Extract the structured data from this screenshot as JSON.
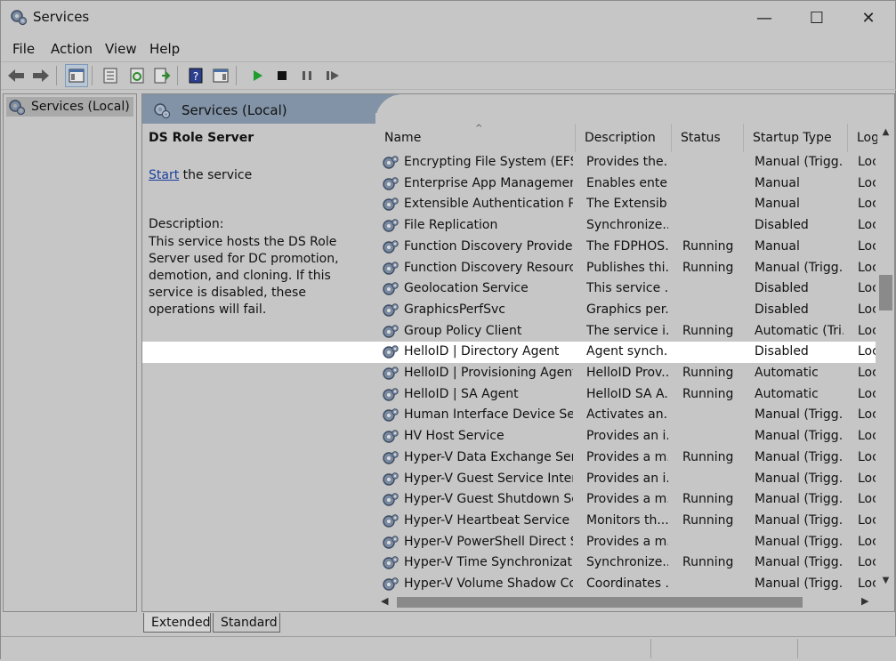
{
  "window": {
    "title": "Services",
    "controls": {
      "minimize": "—",
      "maximize": "☐",
      "close": "✕"
    }
  },
  "menu": {
    "file": "File",
    "action": "Action",
    "view": "View",
    "help": "Help"
  },
  "tree": {
    "item": "Services (Local)"
  },
  "pane": {
    "header": "Services (Local)"
  },
  "details": {
    "service_name": "DS Role Server",
    "start_link": "Start",
    "start_suffix": " the service",
    "description_label": "Description:",
    "description_text": "This service hosts the DS Role Server used for DC promotion, demotion, and cloning. If this service is disabled, these operations will fail."
  },
  "columns": {
    "name": "Name",
    "description": "Description",
    "status": "Status",
    "startup": "Startup Type",
    "log": "Log"
  },
  "rows": [
    {
      "name": "Encrypting File System (EFS)",
      "description": "Provides the...",
      "status": "",
      "startup": "Manual (Trigg...",
      "log": "Loc"
    },
    {
      "name": "Enterprise App Managemen...",
      "description": "Enables ente...",
      "status": "",
      "startup": "Manual",
      "log": "Loc"
    },
    {
      "name": "Extensible Authentication Pr...",
      "description": "The Extensib...",
      "status": "",
      "startup": "Manual",
      "log": "Loc"
    },
    {
      "name": "File Replication",
      "description": "Synchronize...",
      "status": "",
      "startup": "Disabled",
      "log": "Loc"
    },
    {
      "name": "Function Discovery Provider ...",
      "description": "The FDPHOS...",
      "status": "Running",
      "startup": "Manual",
      "log": "Loc"
    },
    {
      "name": "Function Discovery Resourc...",
      "description": "Publishes thi...",
      "status": "Running",
      "startup": "Manual (Trigg...",
      "log": "Loc"
    },
    {
      "name": "Geolocation Service",
      "description": "This service ...",
      "status": "",
      "startup": "Disabled",
      "log": "Loc"
    },
    {
      "name": "GraphicsPerfSvc",
      "description": "Graphics per...",
      "status": "",
      "startup": "Disabled",
      "log": "Loc"
    },
    {
      "name": "Group Policy Client",
      "description": "The service i...",
      "status": "Running",
      "startup": "Automatic (Tri...",
      "log": "Loc"
    },
    {
      "name": "HelloID | Directory Agent",
      "description": "Agent synch...",
      "status": "",
      "startup": "Disabled",
      "log": "Loc",
      "selected": true
    },
    {
      "name": "HelloID | Provisioning Agent",
      "description": "HelloID Prov...",
      "status": "Running",
      "startup": "Automatic",
      "log": "Loc"
    },
    {
      "name": "HelloID | SA Agent",
      "description": "HelloID SA A...",
      "status": "Running",
      "startup": "Automatic",
      "log": "Loc"
    },
    {
      "name": "Human Interface Device Serv...",
      "description": "Activates an...",
      "status": "",
      "startup": "Manual (Trigg...",
      "log": "Loc"
    },
    {
      "name": "HV Host Service",
      "description": "Provides an i...",
      "status": "",
      "startup": "Manual (Trigg...",
      "log": "Loc"
    },
    {
      "name": "Hyper-V Data Exchange Serv...",
      "description": "Provides a m...",
      "status": "Running",
      "startup": "Manual (Trigg...",
      "log": "Loc"
    },
    {
      "name": "Hyper-V Guest Service Interf...",
      "description": "Provides an i...",
      "status": "",
      "startup": "Manual (Trigg...",
      "log": "Loc"
    },
    {
      "name": "Hyper-V Guest Shutdown Se...",
      "description": "Provides a m...",
      "status": "Running",
      "startup": "Manual (Trigg...",
      "log": "Loc"
    },
    {
      "name": "Hyper-V Heartbeat Service",
      "description": "Monitors th...",
      "status": "Running",
      "startup": "Manual (Trigg...",
      "log": "Loc"
    },
    {
      "name": "Hyper-V PowerShell Direct S...",
      "description": "Provides a m...",
      "status": "",
      "startup": "Manual (Trigg...",
      "log": "Loc"
    },
    {
      "name": "Hyper-V Time Synchronizati...",
      "description": "Synchronize...",
      "status": "Running",
      "startup": "Manual (Trigg...",
      "log": "Loc"
    },
    {
      "name": "Hyper-V Volume Shadow Co...",
      "description": "Coordinates ...",
      "status": "",
      "startup": "Manual (Trigg...",
      "log": "Loc"
    }
  ],
  "tabs": {
    "extended": "Extended",
    "standard": "Standard"
  },
  "colors": {
    "header_band": "#8293a7",
    "background": "#c6c6c6",
    "selected_row": "#ffffff",
    "link": "#1a3f9e",
    "play_green": "#1f9d2f"
  }
}
